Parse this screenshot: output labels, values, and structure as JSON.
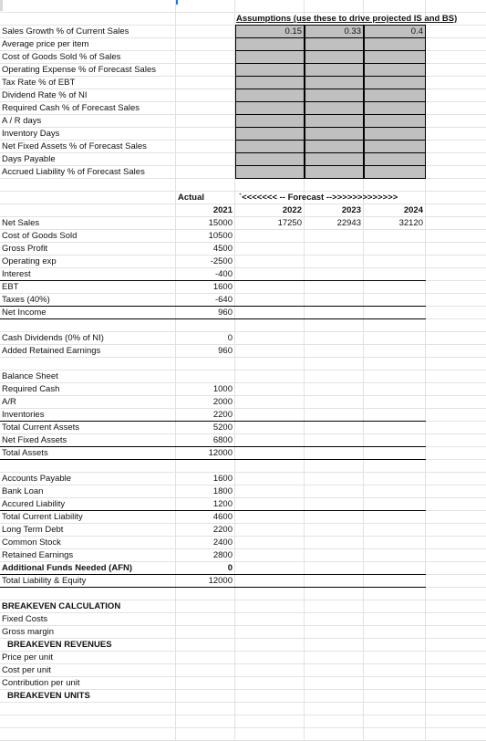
{
  "assumptions": {
    "title": "Assumptions (use these to drive projected IS and BS)",
    "labels": [
      "Sales Growth % of Current Sales",
      "Average price per item",
      "Cost of Goods Sold % of Sales",
      "Operating Expense % of Forecast Sales",
      "Tax Rate % of EBT",
      "Dividend Rate % of NI",
      "Required Cash % of Forecast Sales",
      "A / R days",
      "Inventory Days",
      "Net Fixed Assets % of Forecast Sales",
      "Days Payable",
      "Accrued Liability % of Forecast Sales"
    ],
    "first_row_values": [
      "0.15",
      "0.33",
      "0.4"
    ]
  },
  "headers": {
    "actual": "Actual",
    "forecast": "`<<<<<<< -- Forecast -->>>>>>>>>>>>>",
    "years": [
      "2021",
      "2022",
      "2023",
      "2024"
    ]
  },
  "income_statement": [
    {
      "label": "Net Sales",
      "values": [
        "15000",
        "17250",
        "22943",
        "32120"
      ]
    },
    {
      "label": "Cost of Goods Sold",
      "values": [
        "10500",
        "",
        "",
        ""
      ]
    },
    {
      "label": "Gross Profit",
      "values": [
        "4500",
        "",
        "",
        ""
      ]
    },
    {
      "label": "Operating exp",
      "values": [
        "-2500",
        "",
        "",
        ""
      ]
    },
    {
      "label": "Interest",
      "values": [
        "-400",
        "",
        "",
        ""
      ]
    },
    {
      "label": "EBT",
      "values": [
        "1600",
        "",
        "",
        ""
      ]
    },
    {
      "label": "Taxes (40%)",
      "values": [
        "-640",
        "",
        "",
        ""
      ]
    },
    {
      "label": "Net Income",
      "values": [
        "960",
        "",
        "",
        ""
      ]
    }
  ],
  "dividends": [
    {
      "label": "Cash Dividends (0% of NI)",
      "values": [
        "0"
      ]
    },
    {
      "label": "Added Retained Earnings",
      "values": [
        "960"
      ]
    }
  ],
  "balance_sheet": {
    "title": "Balance Sheet",
    "assets": [
      {
        "label": "Required Cash",
        "value": "1000"
      },
      {
        "label": "A/R",
        "value": "2000"
      },
      {
        "label": "Inventories",
        "value": "2200"
      },
      {
        "label": "Total Current Assets",
        "value": "5200"
      },
      {
        "label": "Net Fixed Assets",
        "value": "6800"
      },
      {
        "label": "Total Assets",
        "value": "12000"
      }
    ],
    "liabilities": [
      {
        "label": "Accounts Payable",
        "value": "1600"
      },
      {
        "label": "Bank Loan",
        "value": "1800"
      },
      {
        "label": "Accured Liability",
        "value": "1200"
      },
      {
        "label": "Total Current Liability",
        "value": "4600"
      },
      {
        "label": "Long Term Debt",
        "value": "2200"
      },
      {
        "label": "Common Stock",
        "value": "2400"
      },
      {
        "label": "Retained Earnings",
        "value": "2800"
      },
      {
        "label": "Additional Funds Needed (AFN)",
        "value": "0"
      },
      {
        "label": "Total Liability & Equity",
        "value": "12000"
      }
    ]
  },
  "breakeven": {
    "title": "BREAKEVEN CALCULATION",
    "items": [
      "Fixed Costs",
      "Gross margin",
      "BREAKEVEN REVENUES",
      "Price per unit",
      "Cost per unit",
      "Contribution per unit",
      "BREAKEVEN UNITS"
    ]
  }
}
